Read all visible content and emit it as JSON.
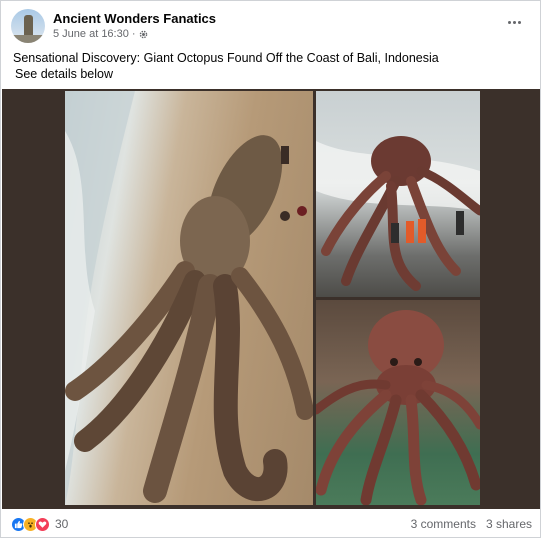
{
  "post": {
    "page_name": "Ancient Wonders Fanatics",
    "timestamp": "5 June at 16:30",
    "separator": "·",
    "privacy_icon": "gear-icon",
    "more_icon": "more-options-icon",
    "text_line1": "Sensational Discovery: Giant Octopus Found Off the Coast of Bali, Indonesia",
    "text_line2": "See details below"
  },
  "media": {
    "photos": [
      "beach-octopus-photo",
      "surf-octopus-photo",
      "market-octopus-photo"
    ],
    "backdrop_color": "#3b302a"
  },
  "footer": {
    "reactions": [
      "like",
      "wow",
      "love"
    ],
    "reaction_count": "30",
    "comments": "3 comments",
    "shares": "3 shares"
  },
  "colors": {
    "like": "#1877f2",
    "wow": "#f7b125",
    "love": "#f33e58",
    "secondary_text": "#65676b"
  }
}
